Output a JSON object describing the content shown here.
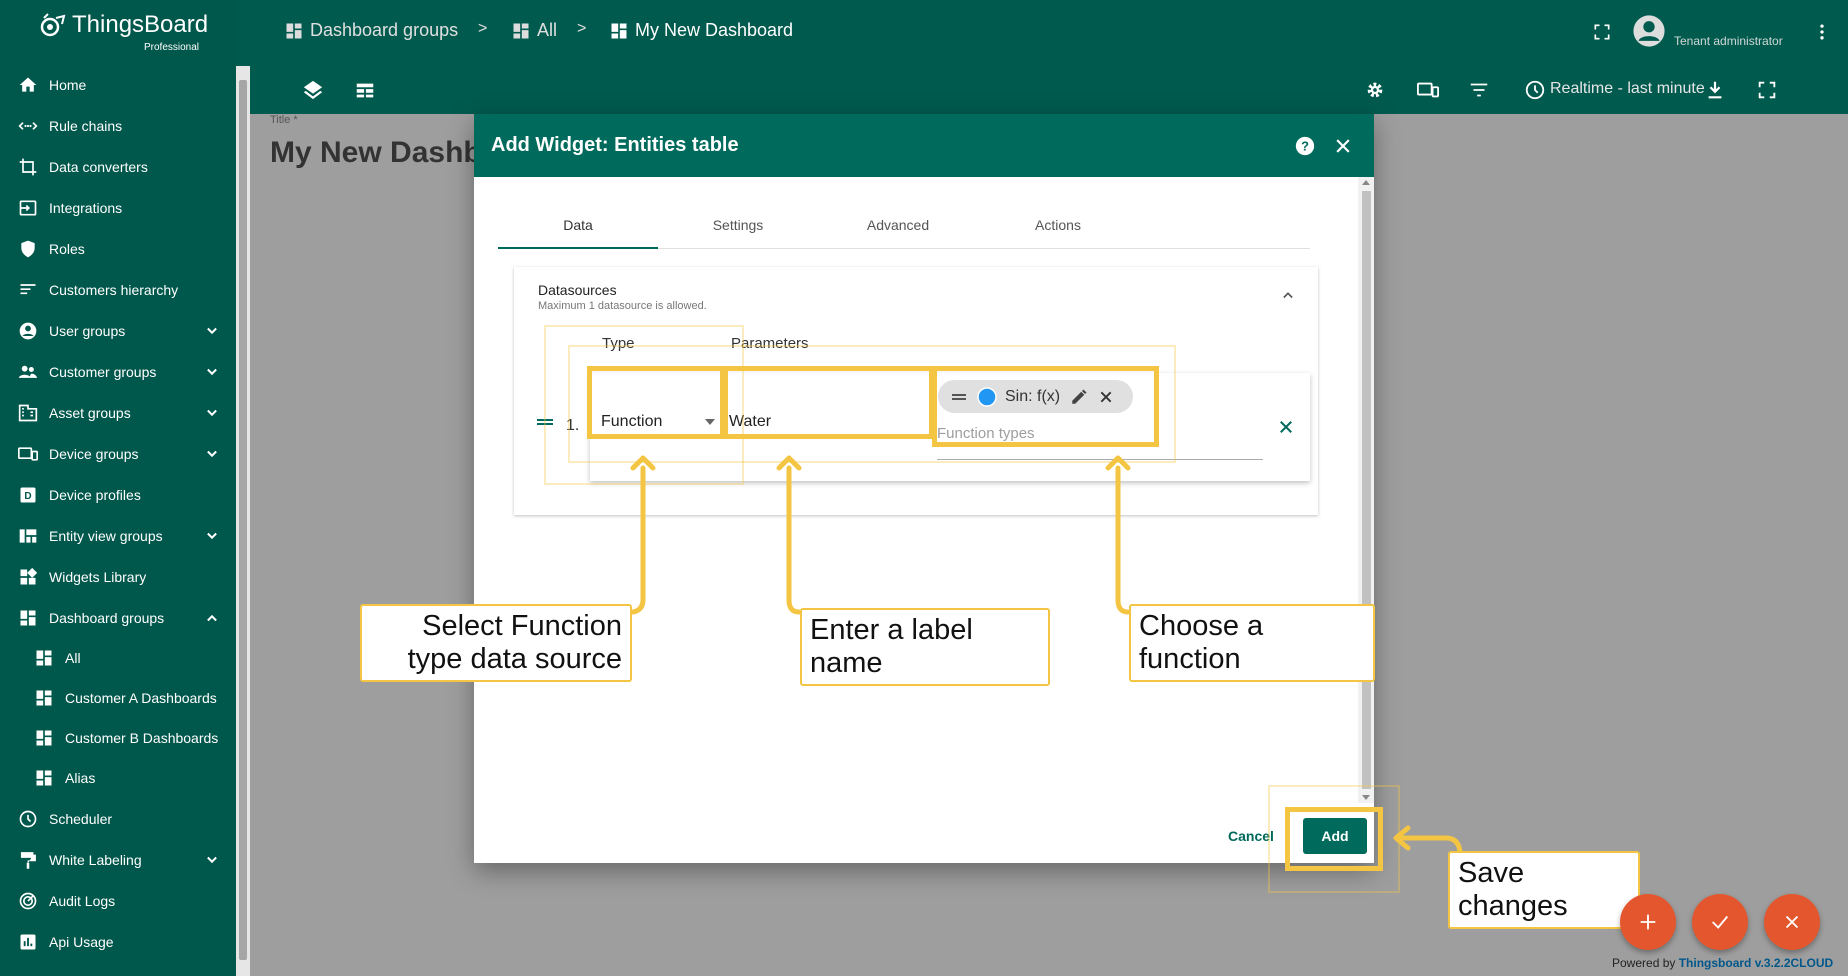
{
  "app": {
    "logo_name": "ThingsBoard",
    "logo_sub": "Professional"
  },
  "sidebar": {
    "items": [
      {
        "label": "Home",
        "icon": "home-icon"
      },
      {
        "label": "Rule chains",
        "icon": "rule-chains-icon"
      },
      {
        "label": "Data converters",
        "icon": "data-converters-icon"
      },
      {
        "label": "Integrations",
        "icon": "integrations-icon"
      },
      {
        "label": "Roles",
        "icon": "shield-icon"
      },
      {
        "label": "Customers hierarchy",
        "icon": "hierarchy-icon"
      },
      {
        "label": "User groups",
        "icon": "account-icon"
      },
      {
        "label": "Customer groups",
        "icon": "people-icon"
      },
      {
        "label": "Asset groups",
        "icon": "domain-icon"
      },
      {
        "label": "Device groups",
        "icon": "devices-icon"
      },
      {
        "label": "Device profiles",
        "icon": "device-profile-icon"
      },
      {
        "label": "Entity view groups",
        "icon": "view-quilt-icon"
      },
      {
        "label": "Widgets Library",
        "icon": "widgets-icon"
      },
      {
        "label": "Dashboard groups",
        "icon": "dashboard-icon"
      },
      {
        "label": "All",
        "icon": "dashboard-icon"
      },
      {
        "label": "Customer A Dashboards",
        "icon": "dashboard-icon"
      },
      {
        "label": "Customer B Dashboards",
        "icon": "dashboard-icon"
      },
      {
        "label": "Alias",
        "icon": "dashboard-icon"
      },
      {
        "label": "Scheduler",
        "icon": "clock-icon"
      },
      {
        "label": "White Labeling",
        "icon": "format-paint-icon"
      },
      {
        "label": "Audit Logs",
        "icon": "track-changes-icon"
      },
      {
        "label": "Api Usage",
        "icon": "insert-chart-icon"
      }
    ]
  },
  "breadcrumb": {
    "items": [
      "Dashboard groups",
      "All",
      "My New Dashboard"
    ],
    "separator": ">"
  },
  "user": {
    "role": "Tenant administrator"
  },
  "toolbar": {
    "timewindow": "Realtime - last minute"
  },
  "dashboard": {
    "title_label": "Title *",
    "title": "My New Dashb"
  },
  "dialog": {
    "title": "Add Widget: Entities table",
    "tabs": [
      "Data",
      "Settings",
      "Advanced",
      "Actions"
    ],
    "datasources": {
      "heading": "Datasources",
      "hint": "Maximum 1 datasource is allowed.",
      "type_label": "Type",
      "params_label": "Parameters",
      "row_index": "1.",
      "type_value": "Function",
      "label_value": "Water",
      "chip_label": "Sin: f(x)",
      "function_types_placeholder": "Function types"
    },
    "cancel_label": "Cancel",
    "add_label": "Add"
  },
  "callouts": {
    "type": "Select Function type data source",
    "label": "Enter a label name",
    "function": "Choose a function",
    "save": "Save changes"
  },
  "footer": {
    "powered_prefix": "Powered by ",
    "powered_link": "Thingsboard v.3.2.2CLOUD"
  },
  "colors": {
    "primary": "#006b5c",
    "sidebar": "#00574b",
    "highlight": "#f4c542",
    "fab": "#e4572e",
    "chip_dot": "#2196f3"
  }
}
